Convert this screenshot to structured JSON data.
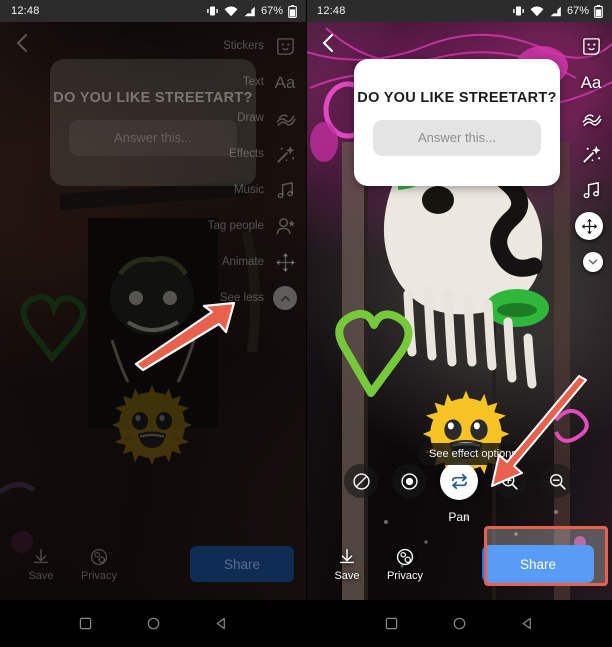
{
  "status_bar": {
    "time": "12:48",
    "battery_percent": "67%",
    "icons": [
      "vibrate-icon",
      "wifi-icon",
      "signal-icon",
      "battery-icon"
    ]
  },
  "panels": [
    {
      "id": "left",
      "state": "dimmed",
      "back_label": "back-chevron",
      "question_card": {
        "question": "DO YOU LIKE STREETART?",
        "answer_placeholder": "Answer this..."
      },
      "tool_rail": [
        {
          "label": "Stickers",
          "icon": "sticker-face-icon",
          "active": false
        },
        {
          "label": "Text",
          "icon": "text-aa-icon",
          "active": false
        },
        {
          "label": "Draw",
          "icon": "draw-squiggle-icon",
          "active": false
        },
        {
          "label": "Effects",
          "icon": "effects-wand-icon",
          "active": false
        },
        {
          "label": "Music",
          "icon": "music-note-icon",
          "active": false
        },
        {
          "label": "Tag people",
          "icon": "tag-person-icon",
          "active": false
        },
        {
          "label": "Animate",
          "icon": "animate-arrows-icon",
          "active": false
        },
        {
          "label": "See less",
          "icon": "chevron-up-icon",
          "active": true
        }
      ],
      "sticker": "sun-emoji-sticker",
      "bottom_bar": {
        "save_label": "Save",
        "save_icon": "save-download-icon",
        "privacy_label": "Privacy",
        "privacy_icon": "privacy-gear-icon",
        "share_label": "Share"
      },
      "annotation": {
        "type": "arrow",
        "points_to": "Animate"
      }
    },
    {
      "id": "right",
      "state": "active",
      "back_label": "back-chevron",
      "question_card": {
        "question": "DO YOU LIKE STREETART?",
        "answer_placeholder": "Answer this..."
      },
      "tool_rail": [
        {
          "label": "",
          "icon": "sticker-face-icon",
          "active": false
        },
        {
          "label": "",
          "icon": "text-aa-icon",
          "active": false
        },
        {
          "label": "",
          "icon": "draw-squiggle-icon",
          "active": false
        },
        {
          "label": "",
          "icon": "effects-wand-icon",
          "active": false
        },
        {
          "label": "",
          "icon": "music-note-icon",
          "active": false
        },
        {
          "label": "",
          "icon": "animate-arrows-icon",
          "active": true
        },
        {
          "label": "",
          "icon": "chevron-down-icon",
          "active": true
        }
      ],
      "sticker": "sun-emoji-sticker",
      "effect_options": {
        "tooltip": "See effect options",
        "selected_label": "Pan",
        "buttons": [
          {
            "name": "none-effect-button",
            "icon": "no-effect-slash-icon",
            "active": false
          },
          {
            "name": "focus-effect-button",
            "icon": "focus-dot-icon",
            "active": false
          },
          {
            "name": "pan-effect-button",
            "icon": "pan-arrows-icon",
            "active": true
          },
          {
            "name": "zoom-in-effect-button",
            "icon": "zoom-in-icon",
            "active": false
          },
          {
            "name": "zoom-out-effect-button",
            "icon": "zoom-out-icon",
            "active": false
          }
        ]
      },
      "bottom_bar": {
        "save_label": "Save",
        "save_icon": "save-download-icon",
        "privacy_label": "Privacy",
        "privacy_icon": "privacy-gear-icon",
        "share_label": "Share"
      },
      "annotation": {
        "type": "arrow",
        "points_to": "Pan"
      },
      "highlight": {
        "target": "Share",
        "color": "#e8614d"
      }
    }
  ],
  "nav_bar": {
    "buttons": [
      {
        "name": "recents-button",
        "icon": "square-icon"
      },
      {
        "name": "home-button",
        "icon": "circle-icon"
      },
      {
        "name": "back-button",
        "icon": "triangle-left-icon"
      }
    ]
  },
  "colors": {
    "share_blue": "#1877f2",
    "highlight_red": "#e8614d",
    "status_bar_bg": "#2c2c2c"
  }
}
